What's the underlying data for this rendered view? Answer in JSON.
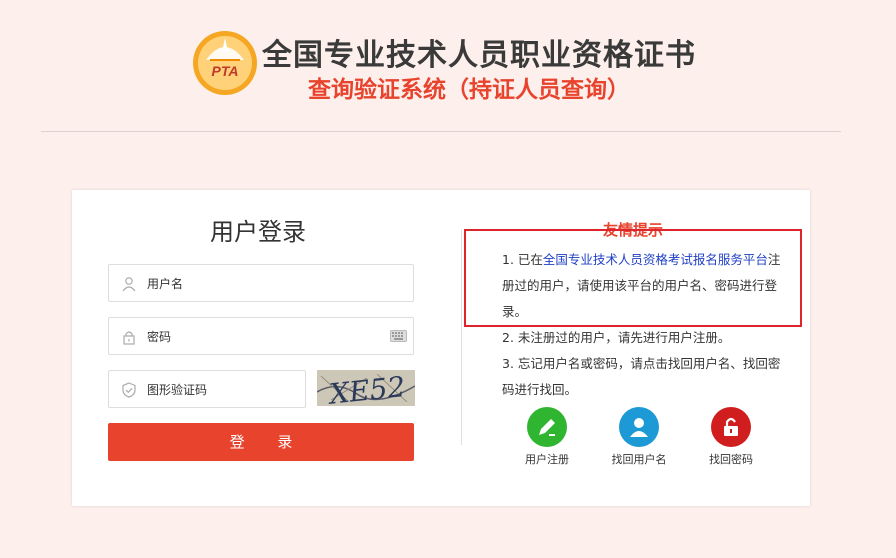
{
  "header": {
    "logo_text": "PTA",
    "title": "全国专业技术人员职业资格证书",
    "subtitle": "查询验证系统（持证人员查询）"
  },
  "login": {
    "title": "用户登录",
    "username_placeholder": "用户名",
    "password_placeholder": "密码",
    "captcha_placeholder": "图形验证码",
    "captcha_text": "XE52",
    "submit_label": "登 录"
  },
  "tips": {
    "title": "友情提示",
    "item1_prefix": "1. 已在",
    "item1_link": "全国专业技术人员资格考试报名服务平台",
    "item1_suffix": "注册过的用户，请使用该平台的用户名、密码进行登录。",
    "item2": "2. 未注册过的用户，请先进行用户注册。",
    "item3": "3. 忘记用户名或密码，请点击找回用户名、找回密码进行找回。"
  },
  "actions": [
    {
      "label": "用户注册",
      "color": "#2fb52f",
      "icon": "pencil-icon"
    },
    {
      "label": "找回用户名",
      "color": "#1d9ad6",
      "icon": "user-icon"
    },
    {
      "label": "找回密码",
      "color": "#d01d1d",
      "icon": "lock-icon"
    }
  ],
  "colors": {
    "accent": "#e8432d",
    "link": "#1f3fc4",
    "highlight_box": "#e0242b"
  }
}
